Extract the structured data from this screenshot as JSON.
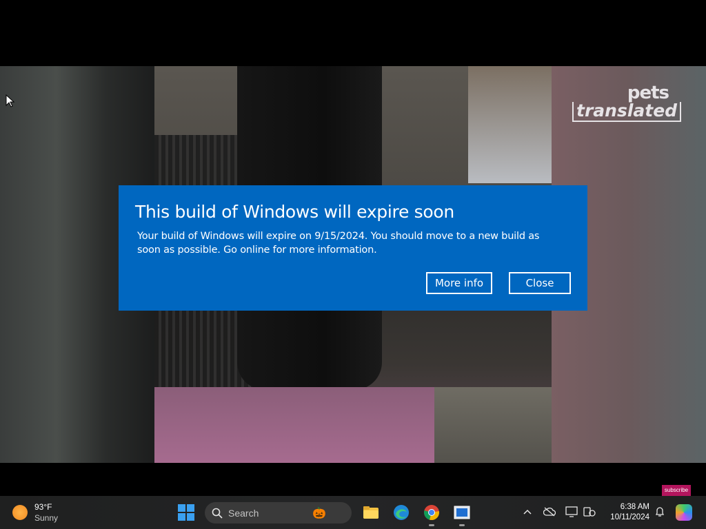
{
  "background": {
    "watermark_line1": "pets",
    "watermark_line2": "translated",
    "subscribe_label": "subscribe"
  },
  "dialog": {
    "title": "This build of Windows will expire soon",
    "body": "Your build of Windows will expire on 9/15/2024. You should move to a new build as soon as possible. Go online for more information.",
    "more_info_label": "More info",
    "close_label": "Close",
    "bg_color": "#0067c0"
  },
  "taskbar": {
    "weather": {
      "temperature": "93°F",
      "condition": "Sunny",
      "icon": "sun-icon"
    },
    "search_placeholder": "Search",
    "pinned_apps": [
      "start-icon",
      "file-explorer-icon",
      "edge-icon",
      "chrome-icon",
      "app-window-icon"
    ],
    "tray_icons": [
      "chevron-up-icon",
      "cloud-offline-icon",
      "display-icon",
      "phone-link-icon",
      "notification-bell-icon",
      "copilot-icon"
    ],
    "time": "6:38 AM",
    "date": "10/11/2024"
  }
}
